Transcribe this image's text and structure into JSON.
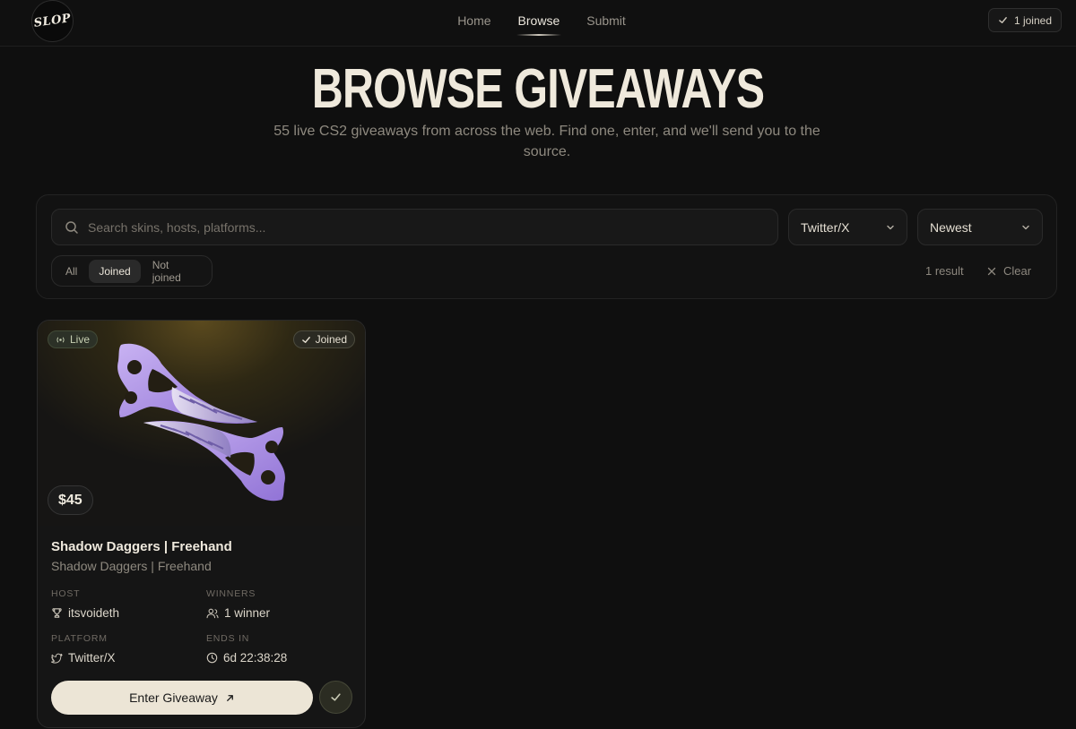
{
  "nav": {
    "logo_text": "SLOP",
    "links": [
      {
        "label": "Home"
      },
      {
        "label": "Browse"
      },
      {
        "label": "Submit"
      }
    ],
    "joined_label": "1 joined"
  },
  "hero": {
    "title": "BROWSE GIVEAWAYS",
    "subtitle": "55 live CS2 giveaways from across the web. Find one, enter, and we'll send you to the source."
  },
  "filters": {
    "search_placeholder": "Search skins, hosts, platforms...",
    "search_value": "",
    "platform_selected": "Twitter/X",
    "sort_selected": "Newest",
    "segments": [
      {
        "label": "All"
      },
      {
        "label": "Joined"
      },
      {
        "label": "Not joined"
      }
    ],
    "active_segment": "Joined",
    "result_count": "1 result",
    "clear_label": "Clear"
  },
  "card": {
    "live_label": "Live",
    "joined_label": "Joined",
    "price": "$45",
    "title": "Shadow Daggers | Freehand",
    "subtitle": "Shadow Daggers | Freehand",
    "host_label": "HOST",
    "host_value": "itsvoideth",
    "winners_label": "WINNERS",
    "winners_value": "1 winner",
    "platform_label": "PLATFORM",
    "platform_value": "Twitter/X",
    "ends_label": "ENDS IN",
    "ends_value": "6d 22:38:28",
    "enter_label": "Enter Giveaway"
  },
  "colors": {
    "background": "#0f0f0f",
    "accent_cream": "#ece5d6",
    "knife_purple": "#b59ae6"
  },
  "icons": [
    "search-icon",
    "chevron-down-icon",
    "check-icon",
    "close-icon",
    "live-signal-icon",
    "trophy-icon",
    "users-icon",
    "twitter-icon",
    "clock-icon",
    "arrow-up-right-icon"
  ]
}
